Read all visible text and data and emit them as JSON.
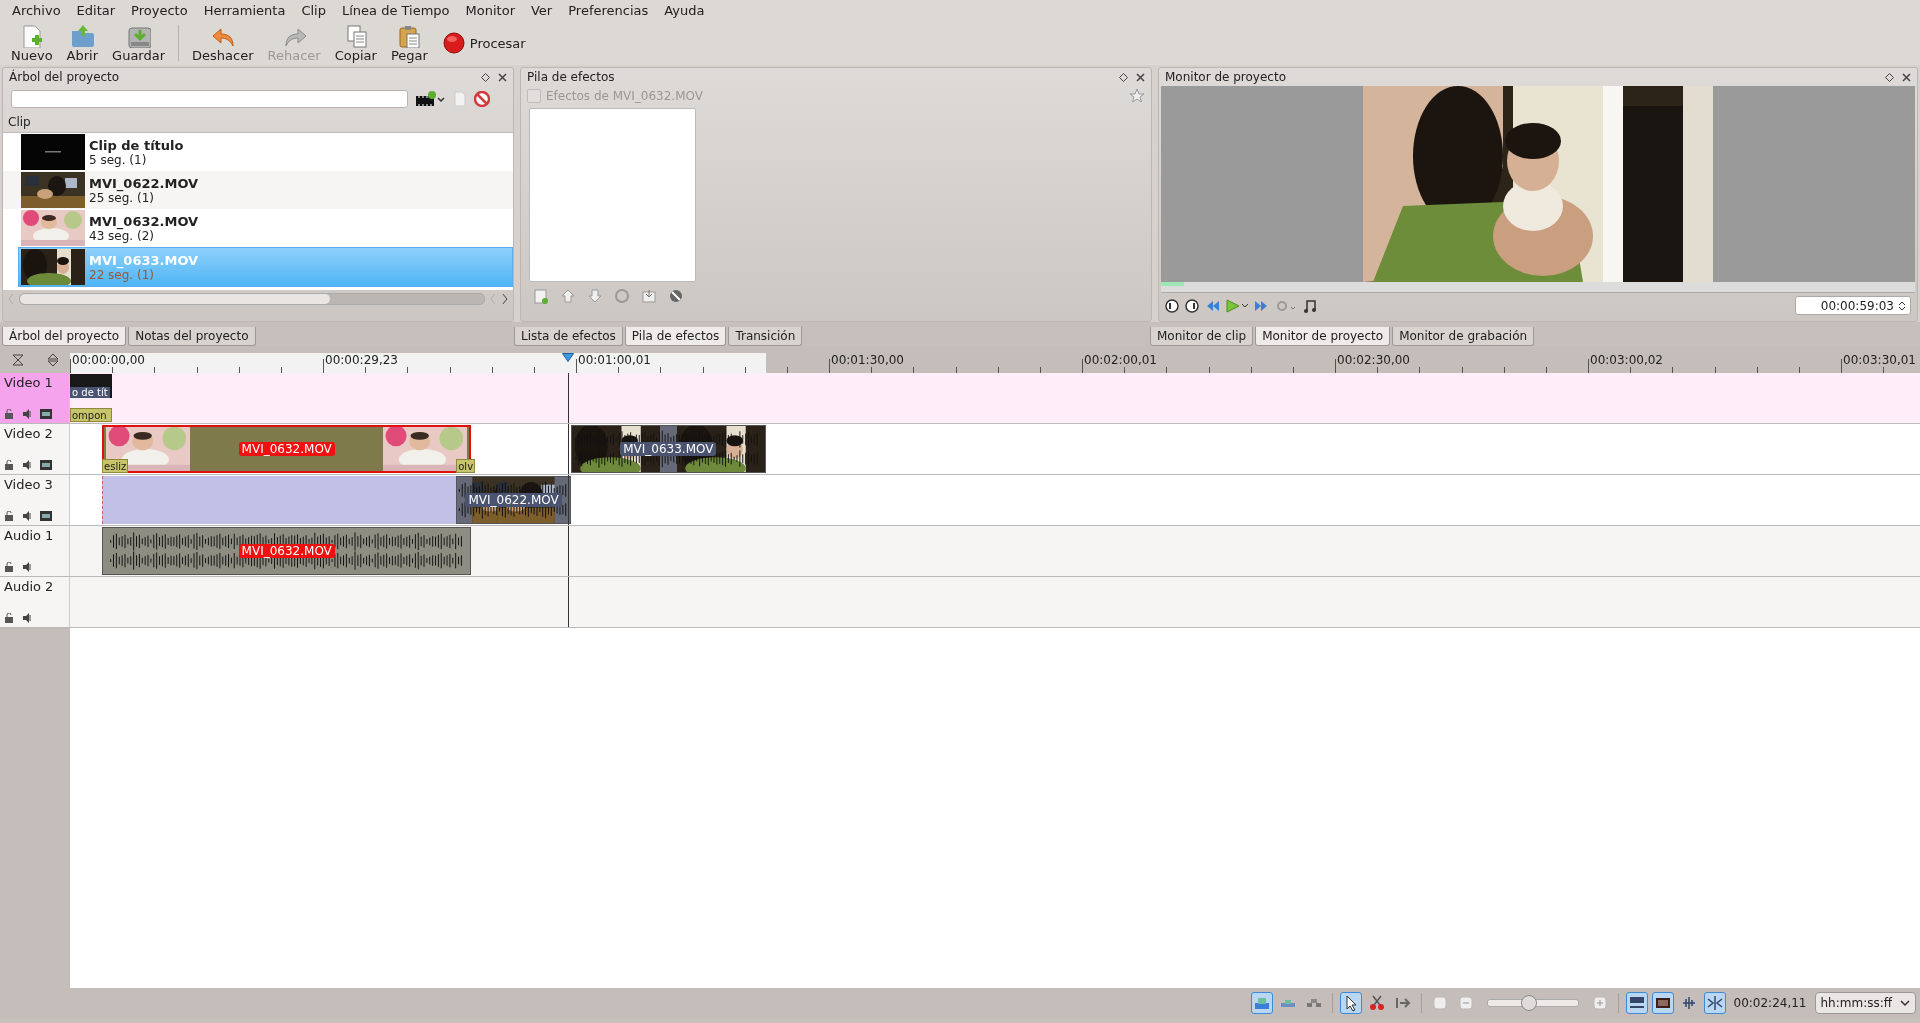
{
  "menu": [
    "Archivo",
    "Editar",
    "Proyecto",
    "Herramienta",
    "Clip",
    "Línea de Tiempo",
    "Monitor",
    "Ver",
    "Preferencias",
    "Ayuda"
  ],
  "toolbar": [
    [
      {
        "label": "Nuevo",
        "kind": "tool",
        "disabled": false
      },
      {
        "label": "Abrir",
        "kind": "tool",
        "disabled": false
      },
      {
        "label": "Guardar",
        "kind": "tool",
        "disabled": false
      }
    ],
    [
      {
        "label": "Deshacer",
        "kind": "tool",
        "disabled": false
      },
      {
        "label": "Rehacer",
        "kind": "tool",
        "disabled": true
      },
      {
        "label": "Copiar",
        "kind": "tool",
        "disabled": false
      },
      {
        "label": "Pegar",
        "kind": "tool",
        "disabled": false
      },
      {
        "label": "Procesar",
        "kind": "render",
        "disabled": false
      }
    ]
  ],
  "project_tree": {
    "title": "Árbol del proyecto",
    "column": "Clip",
    "items": [
      {
        "name": "Clip de título",
        "duration": "5 seg. (1)",
        "selected": false
      },
      {
        "name": "MVI_0622.MOV",
        "duration": "25 seg. (1)",
        "selected": false
      },
      {
        "name": "MVI_0632.MOV",
        "duration": "43 seg. (2)",
        "selected": false
      },
      {
        "name": "MVI_0633.MOV",
        "duration": "22 seg. (1)",
        "selected": true
      }
    ]
  },
  "effect_stack": {
    "title": "Pila de efectos",
    "checkbox": {
      "label": "Efectos de MVI_0632.MOV",
      "checked": false,
      "disabled": true
    }
  },
  "monitor": {
    "title": "Monitor de proyecto",
    "timecode": "00:00:59:03",
    "level": 0.03
  },
  "tab_groups": [
    [
      {
        "label": "Árbol del proyecto",
        "selected": true
      },
      {
        "label": "Notas del proyecto",
        "selected": false
      }
    ],
    [
      {
        "label": "Lista de efectos",
        "selected": false
      },
      {
        "label": "Pila de efectos",
        "selected": true
      },
      {
        "label": "Transición",
        "selected": false
      }
    ],
    [
      {
        "label": "Monitor de clip",
        "selected": false
      },
      {
        "label": "Monitor de proyecto",
        "selected": true
      },
      {
        "label": "Monitor de grabación",
        "selected": false
      }
    ]
  ],
  "timeline": {
    "ruler": [
      "00:00:00,00",
      "00:00:29,23",
      "00:01:00,01",
      "00:01:30,00",
      "00:02:00,01",
      "00:02:30,00",
      "00:03:00,02",
      "00:03:30,01"
    ],
    "tracks": [
      {
        "name": "Video 1",
        "kind": "video",
        "selected": true,
        "clips": [
          {
            "kind": "title",
            "label": "o de tít",
            "selected": false
          },
          {
            "kind": "transition",
            "label": "ompon"
          }
        ]
      },
      {
        "name": "Video 2",
        "kind": "video",
        "selected": false,
        "clips": [
          {
            "kind": "video",
            "label": "MVI_0632.MOV",
            "selected": true
          },
          {
            "kind": "transition",
            "label": "esliz"
          },
          {
            "kind": "transition",
            "label": "olv"
          },
          {
            "kind": "video",
            "label": "MVI_0633.MOV",
            "selected": false
          }
        ]
      },
      {
        "name": "Video 3",
        "kind": "video",
        "selected": false,
        "clips": [
          {
            "kind": "composite"
          },
          {
            "kind": "video",
            "label": "MVI_0622.MOV",
            "selected": false
          }
        ]
      },
      {
        "name": "Audio 1",
        "kind": "audio",
        "selected": false,
        "clips": [
          {
            "kind": "audio",
            "label": "MVI_0632.MOV",
            "selected": true
          }
        ]
      },
      {
        "name": "Audio 2",
        "kind": "audio",
        "selected": false
      }
    ]
  },
  "status_bar": {
    "tools": [
      {
        "on": true
      },
      {
        "on": false
      },
      {
        "on": false
      },
      {
        "on": true
      },
      {
        "on": false
      },
      {
        "on": false
      },
      {
        "on": false
      },
      {
        "on": false
      },
      {
        "on": false
      },
      {
        "on": true
      },
      {
        "on": true
      },
      {
        "on": false
      },
      {
        "on": true
      }
    ],
    "zoom": {
      "level": 0.45
    },
    "timecode": "00:02:24,11",
    "format": "hh:mm:ss:ff"
  }
}
